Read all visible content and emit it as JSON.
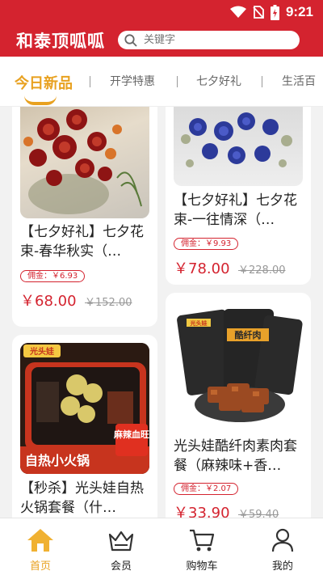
{
  "status_bar": {
    "time": "9:21"
  },
  "header": {
    "title": "和泰顶呱呱",
    "search_placeholder": "关键字"
  },
  "tabs": [
    {
      "label": "今日新品",
      "active": true
    },
    {
      "label": "开学特惠"
    },
    {
      "label": "七夕好礼"
    },
    {
      "label": "生活百"
    }
  ],
  "products": [
    {
      "title": "【七夕好礼】七夕花束-春华秋实（…",
      "commission": "佣金：￥6.93",
      "price": "￥68.00",
      "original_price": "￥152.00"
    },
    {
      "title": "【七夕好礼】七夕花束-一往情深（…",
      "commission": "佣金：￥9.93",
      "price": "￥78.00",
      "original_price": "￥228.00"
    },
    {
      "title": "【秒杀】光头娃自热火锅套餐（什…",
      "image_text_1": "光头娃",
      "image_text_2": "自热小火锅",
      "image_text_3": "麻辣血旺"
    },
    {
      "title": "光头娃酷纤肉素肉套餐（麻辣味+香…",
      "commission": "佣金：￥2.07",
      "price": "￥33.90",
      "original_price": "￥59.40",
      "image_text_1": "酷纤肉",
      "image_text_2": "光头娃"
    }
  ],
  "nav": [
    {
      "label": "首页",
      "active": true
    },
    {
      "label": "会员"
    },
    {
      "label": "购物车"
    },
    {
      "label": "我的"
    }
  ],
  "colors": {
    "brand_red": "#d4232f",
    "accent_orange": "#e8a120"
  }
}
